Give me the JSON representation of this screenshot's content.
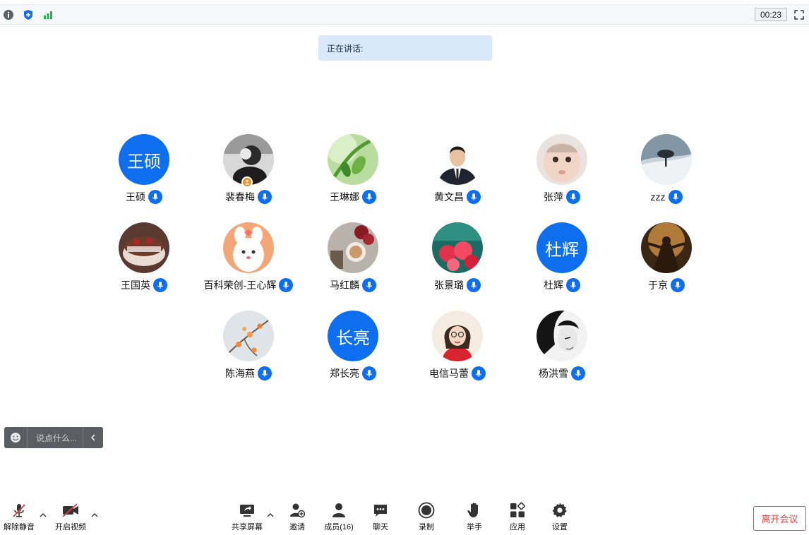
{
  "topbar": {
    "icons": [
      "info-icon",
      "shield-icon",
      "signal-icon"
    ],
    "timer": "00:23",
    "fullscreen_icon": "fullscreen-icon"
  },
  "speaking": {
    "label": "正在讲话:"
  },
  "participants": [
    {
      "name": "王硕",
      "avatar_text": "王硕"
    },
    {
      "name": "裴春梅",
      "avatar_photo": "woman-portrait-bw",
      "host": true
    },
    {
      "name": "王琳娜",
      "avatar_photo": "green-leaves"
    },
    {
      "name": "黄文昌",
      "avatar_photo": "man-in-suit"
    },
    {
      "name": "张萍",
      "avatar_photo": "baby"
    },
    {
      "name": "zzz",
      "avatar_photo": "lone-tree-snow"
    },
    {
      "name": "王国英",
      "avatar_photo": "tiramisu-cake"
    },
    {
      "name": "百科荣创-王心辉",
      "avatar_photo": "cartoon-bunny"
    },
    {
      "name": "马红麟",
      "avatar_photo": "coffee-flowers"
    },
    {
      "name": "张景璐",
      "avatar_photo": "red-flowers"
    },
    {
      "name": "杜辉",
      "avatar_text": "杜辉"
    },
    {
      "name": "于京",
      "avatar_photo": "movie-scene"
    },
    {
      "name": "陈海燕",
      "avatar_photo": "persimmon-branch"
    },
    {
      "name": "郑长亮",
      "avatar_text": "长亮"
    },
    {
      "name": "电信马蕾",
      "avatar_photo": "cartoon-girl-glasses"
    },
    {
      "name": "杨洪雪",
      "avatar_photo": "woman-profile-bw"
    }
  ],
  "chat": {
    "placeholder": "说点什么..."
  },
  "toolbar": {
    "unmute": "解除静音",
    "video": "开启视频",
    "share": "共享屏幕",
    "invite": "邀请",
    "members": "成员(16)",
    "chat": "聊天",
    "record": "录制",
    "raise_hand": "举手",
    "apps": "应用",
    "settings": "设置",
    "leave": "离开会议"
  },
  "colors": {
    "accent": "#0e6ef0",
    "leave": "#e04848",
    "speaking_bg": "#d9e8fb"
  }
}
